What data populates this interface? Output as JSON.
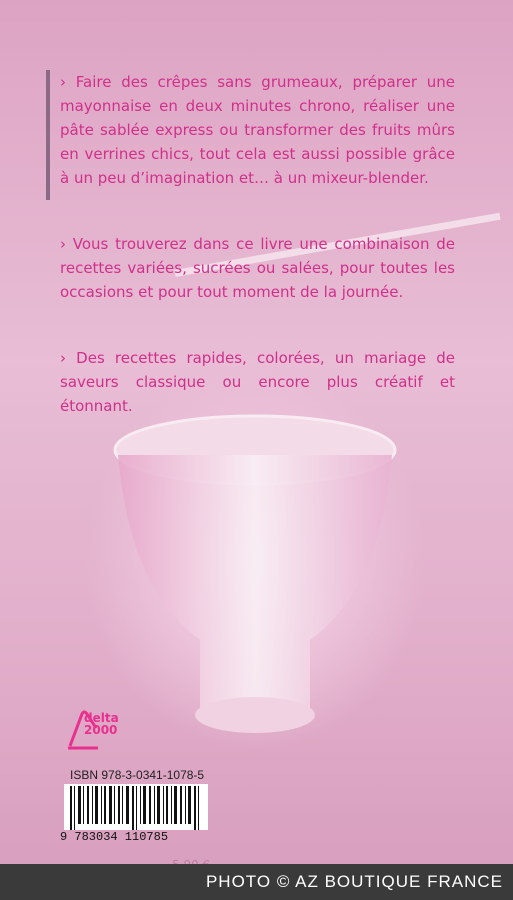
{
  "paragraphs": [
    "› Faire des crêpes sans grumeaux, préparer une mayonnaise en deux minutes chrono, réaliser une pâte sablée express ou transformer des fruits mûrs en verrines chics, tout cela est aussi possible grâce à un peu d’imagination et… à un mixeur-blender.",
    "› Vous trouverez dans ce livre une combinaison de recettes variées, sucrées ou salées, pour toutes les occasions et pour tout moment de la journée.",
    "› Des recettes rapides, colorées, un mariage de saveurs classique ou encore plus créatif et étonnant."
  ],
  "logo": {
    "line1": "delta",
    "line2": "2000"
  },
  "isbn": "ISBN 978-3-0341-1078-5",
  "barcode_number": "9 783034 110785",
  "price": "5,90 €",
  "credit": "PHOTO © AZ BOUTIQUE FRANCE",
  "colors": {
    "text": "#d0308a",
    "logo": "#e8318f",
    "background": "#e7b9d3"
  }
}
